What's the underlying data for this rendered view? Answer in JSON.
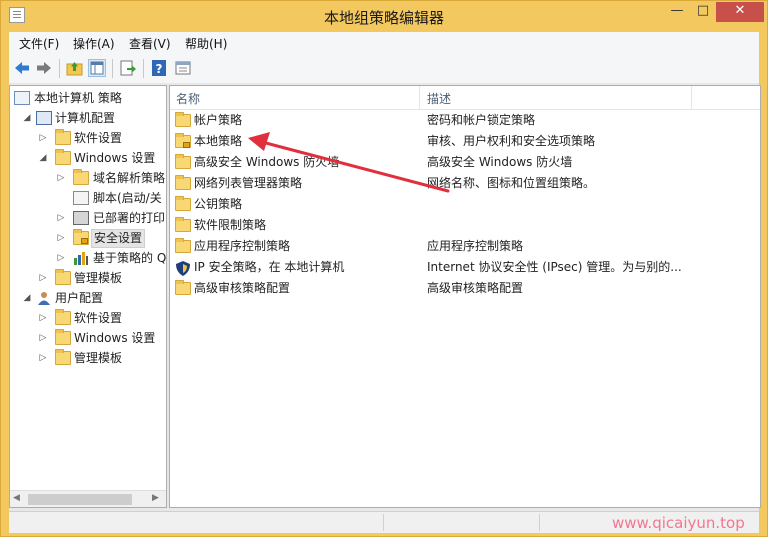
{
  "window": {
    "title": "本地组策略编辑器"
  },
  "window_controls": {
    "minimize": "—",
    "maximize": "□",
    "close": "✕"
  },
  "menu": [
    "文件(F)",
    "操作(A)",
    "查看(V)",
    "帮助(H)"
  ],
  "toolbar": {
    "buttons": [
      "back-icon",
      "forward-icon",
      "up-folder-icon",
      "show-hide-tree-icon",
      "export-list-icon",
      "help-icon",
      "properties-icon"
    ]
  },
  "tree": {
    "root": "本地计算机 策略",
    "computer_config": "计算机配置",
    "computer_software": "软件设置",
    "computer_windows": "Windows 设置",
    "dns": "域名解析策略",
    "scripts": "脚本(启动/关",
    "printers": "已部署的打印",
    "security": "安全设置",
    "qos": "基于策略的 Q",
    "computer_admin": "管理模板",
    "user_config": "用户配置",
    "user_software": "软件设置",
    "user_windows": "Windows 设置",
    "user_admin": "管理模板"
  },
  "list": {
    "columns": {
      "name": "名称",
      "description": "描述"
    },
    "rows": [
      {
        "name": "帐户策略",
        "description": "密码和帐户锁定策略",
        "icon": "folder-icon"
      },
      {
        "name": "本地策略",
        "description": "审核、用户权利和安全选项策略",
        "icon": "locked-folder-icon"
      },
      {
        "name": "高级安全 Windows 防火墙",
        "description": "高级安全 Windows 防火墙",
        "icon": "folder-icon"
      },
      {
        "name": "网络列表管理器策略",
        "description": "网络名称、图标和位置组策略。",
        "icon": "folder-icon"
      },
      {
        "name": "公钥策略",
        "description": "",
        "icon": "folder-icon"
      },
      {
        "name": "软件限制策略",
        "description": "",
        "icon": "folder-icon"
      },
      {
        "name": "应用程序控制策略",
        "description": "应用程序控制策略",
        "icon": "folder-icon"
      },
      {
        "name": "IP 安全策略，在 本地计算机",
        "description": "Internet 协议安全性 (IPsec) 管理。为与别的...",
        "icon": "ipsec-shield-icon"
      },
      {
        "name": "高级审核策略配置",
        "description": "高级审核策略配置",
        "icon": "folder-icon"
      }
    ]
  },
  "colors": {
    "window_frame": "#f3c85e",
    "annotation_arrow": "#e02f3d",
    "watermark": "#f4758f"
  },
  "watermark": "www.qicaiyun.top"
}
